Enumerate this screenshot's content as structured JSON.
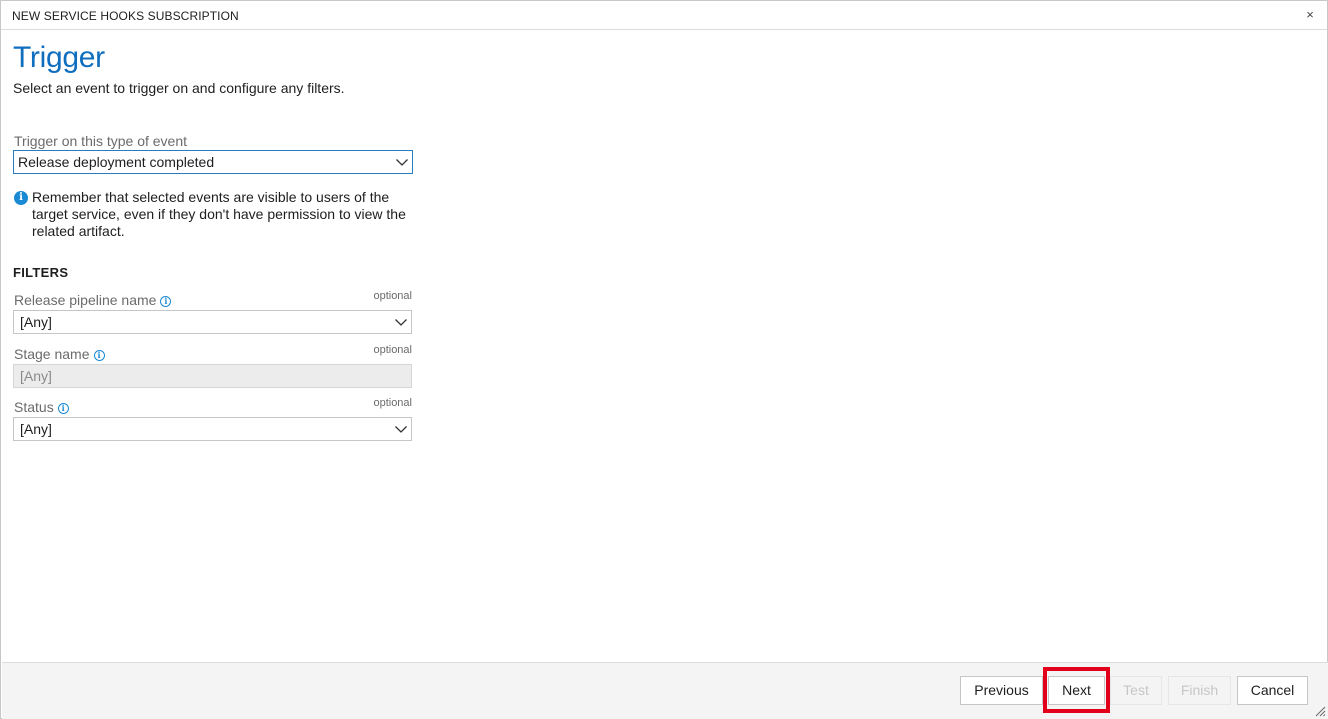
{
  "dialog": {
    "title": "NEW SERVICE HOOKS SUBSCRIPTION",
    "close_glyph": "×"
  },
  "page": {
    "heading": "Trigger",
    "subheading": "Select an event to trigger on and configure any filters."
  },
  "event": {
    "label": "Trigger on this type of event",
    "value": "Release deployment completed"
  },
  "note": {
    "text": "Remember that selected events are visible to users of the target service, even if they don't have permission to view the related artifact."
  },
  "filters": {
    "heading": "FILTERS",
    "optional_label": "optional",
    "release_pipeline": {
      "label": "Release pipeline name",
      "value": "[Any]"
    },
    "stage": {
      "label": "Stage name",
      "value": "[Any]"
    },
    "status": {
      "label": "Status",
      "value": "[Any]"
    }
  },
  "footer": {
    "previous": "Previous",
    "next": "Next",
    "test": "Test",
    "finish": "Finish",
    "cancel": "Cancel"
  },
  "icons": {
    "info": "i",
    "chevron": "chevron-down-icon",
    "close": "close-icon",
    "resize": "resize-grip-icon"
  },
  "colors": {
    "heading": "#106ebe",
    "info": "#1a8ad4",
    "highlight": "#e3001b",
    "focus_border": "#2b7bbf"
  }
}
